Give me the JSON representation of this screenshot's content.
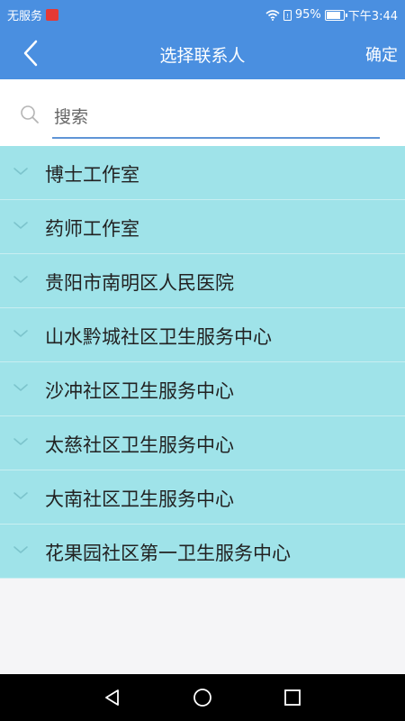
{
  "status_bar": {
    "carrier": "无服务",
    "battery": "95%",
    "battery_level": 0.95,
    "time": "下午3:44"
  },
  "header": {
    "title": "选择联系人",
    "confirm_label": "确定"
  },
  "search": {
    "placeholder": "搜索"
  },
  "groups": [
    {
      "label": "博士工作室"
    },
    {
      "label": "药师工作室"
    },
    {
      "label": "贵阳市南明区人民医院"
    },
    {
      "label": "山水黔城社区卫生服务中心"
    },
    {
      "label": "沙冲社区卫生服务中心"
    },
    {
      "label": "太慈社区卫生服务中心"
    },
    {
      "label": "大南社区卫生服务中心"
    },
    {
      "label": "花果园社区第一卫生服务中心"
    }
  ],
  "colors": {
    "header_bg": "#4a8fe0",
    "group_bg": "#9fe3e9",
    "search_underline": "#5f95d6"
  },
  "icons": [
    "back-arrow-icon",
    "search-icon",
    "chevron-down-icon",
    "wifi-icon",
    "battery-icon",
    "nav-back-icon",
    "nav-home-icon",
    "nav-recents-icon"
  ]
}
